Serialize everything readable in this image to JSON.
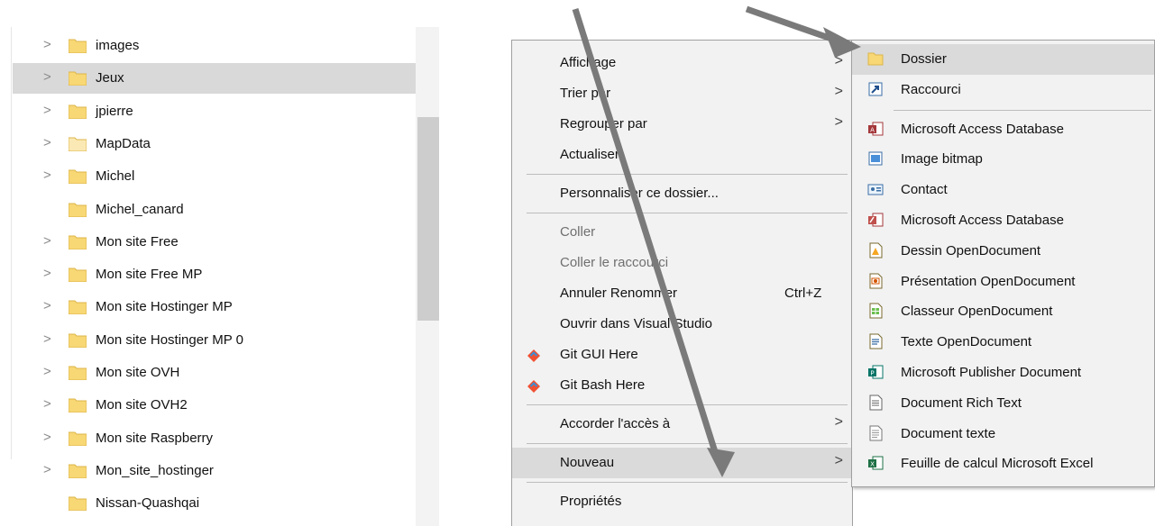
{
  "tree": {
    "items": [
      {
        "label": "images",
        "has_children": true,
        "selected": false
      },
      {
        "label": "Jeux",
        "has_children": true,
        "selected": true
      },
      {
        "label": "jpierre",
        "has_children": true,
        "selected": false
      },
      {
        "label": "MapData",
        "has_children": true,
        "selected": false
      },
      {
        "label": "Michel",
        "has_children": true,
        "selected": false
      },
      {
        "label": "Michel_canard",
        "has_children": false,
        "selected": false
      },
      {
        "label": "Mon site Free",
        "has_children": true,
        "selected": false
      },
      {
        "label": "Mon site Free MP",
        "has_children": true,
        "selected": false
      },
      {
        "label": "Mon site Hostinger MP",
        "has_children": true,
        "selected": false
      },
      {
        "label": "Mon site Hostinger MP 0",
        "has_children": true,
        "selected": false
      },
      {
        "label": "Mon site OVH",
        "has_children": true,
        "selected": false
      },
      {
        "label": "Mon site OVH2",
        "has_children": true,
        "selected": false
      },
      {
        "label": "Mon site Raspberry",
        "has_children": true,
        "selected": false
      },
      {
        "label": "Mon_site_hostinger",
        "has_children": true,
        "selected": false
      },
      {
        "label": "Nissan-Quashqai",
        "has_children": false,
        "selected": false
      }
    ],
    "chevron_glyph": ">"
  },
  "context_menu": {
    "items": [
      {
        "label": "Affichage",
        "submenu": true
      },
      {
        "label": "Trier par",
        "submenu": true
      },
      {
        "label": "Regrouper par",
        "submenu": true
      },
      {
        "label": "Actualiser"
      },
      {
        "separator": true
      },
      {
        "label": "Personnaliser ce dossier..."
      },
      {
        "separator": true
      },
      {
        "label": "Coller",
        "disabled": true
      },
      {
        "label": "Coller le raccourci",
        "disabled": true
      },
      {
        "label": "Annuler Renommer",
        "shortcut": "Ctrl+Z"
      },
      {
        "label": "Ouvrir dans Visual Studio"
      },
      {
        "label": "Git GUI Here",
        "icon": "git-icon"
      },
      {
        "label": "Git Bash Here",
        "icon": "git-icon"
      },
      {
        "separator": true
      },
      {
        "label": "Accorder l'accès à",
        "submenu": true
      },
      {
        "separator": true
      },
      {
        "label": "Nouveau",
        "submenu": true,
        "highlight": true
      },
      {
        "separator": true
      },
      {
        "label": "Propriétés"
      }
    ],
    "submenu_glyph": ">"
  },
  "new_submenu": {
    "items": [
      {
        "label": "Dossier",
        "icon": "folder-icon",
        "highlight": true
      },
      {
        "label": "Raccourci",
        "icon": "shortcut-icon"
      },
      {
        "separator": true
      },
      {
        "label": "Microsoft Access Database",
        "icon": "access-icon"
      },
      {
        "label": "Image bitmap",
        "icon": "bitmap-icon"
      },
      {
        "label": "Contact",
        "icon": "contact-icon"
      },
      {
        "label": "Microsoft Access Database",
        "icon": "access-alt-icon"
      },
      {
        "label": "Dessin OpenDocument",
        "icon": "odg-icon"
      },
      {
        "label": "Présentation OpenDocument",
        "icon": "odp-icon"
      },
      {
        "label": "Classeur OpenDocument",
        "icon": "ods-icon"
      },
      {
        "label": "Texte OpenDocument",
        "icon": "odt-icon"
      },
      {
        "label": "Microsoft Publisher Document",
        "icon": "publisher-icon"
      },
      {
        "label": "Document Rich Text",
        "icon": "richtext-icon"
      },
      {
        "label": "Document texte",
        "icon": "textdoc-icon"
      },
      {
        "label": "Feuille de calcul Microsoft Excel",
        "icon": "excel-icon"
      }
    ]
  },
  "colors": {
    "selection": "#d9d9d9",
    "menu_bg": "#f2f2f2",
    "folder_yellow": "#f8d775",
    "arrow_gray": "#7a7a7a"
  }
}
